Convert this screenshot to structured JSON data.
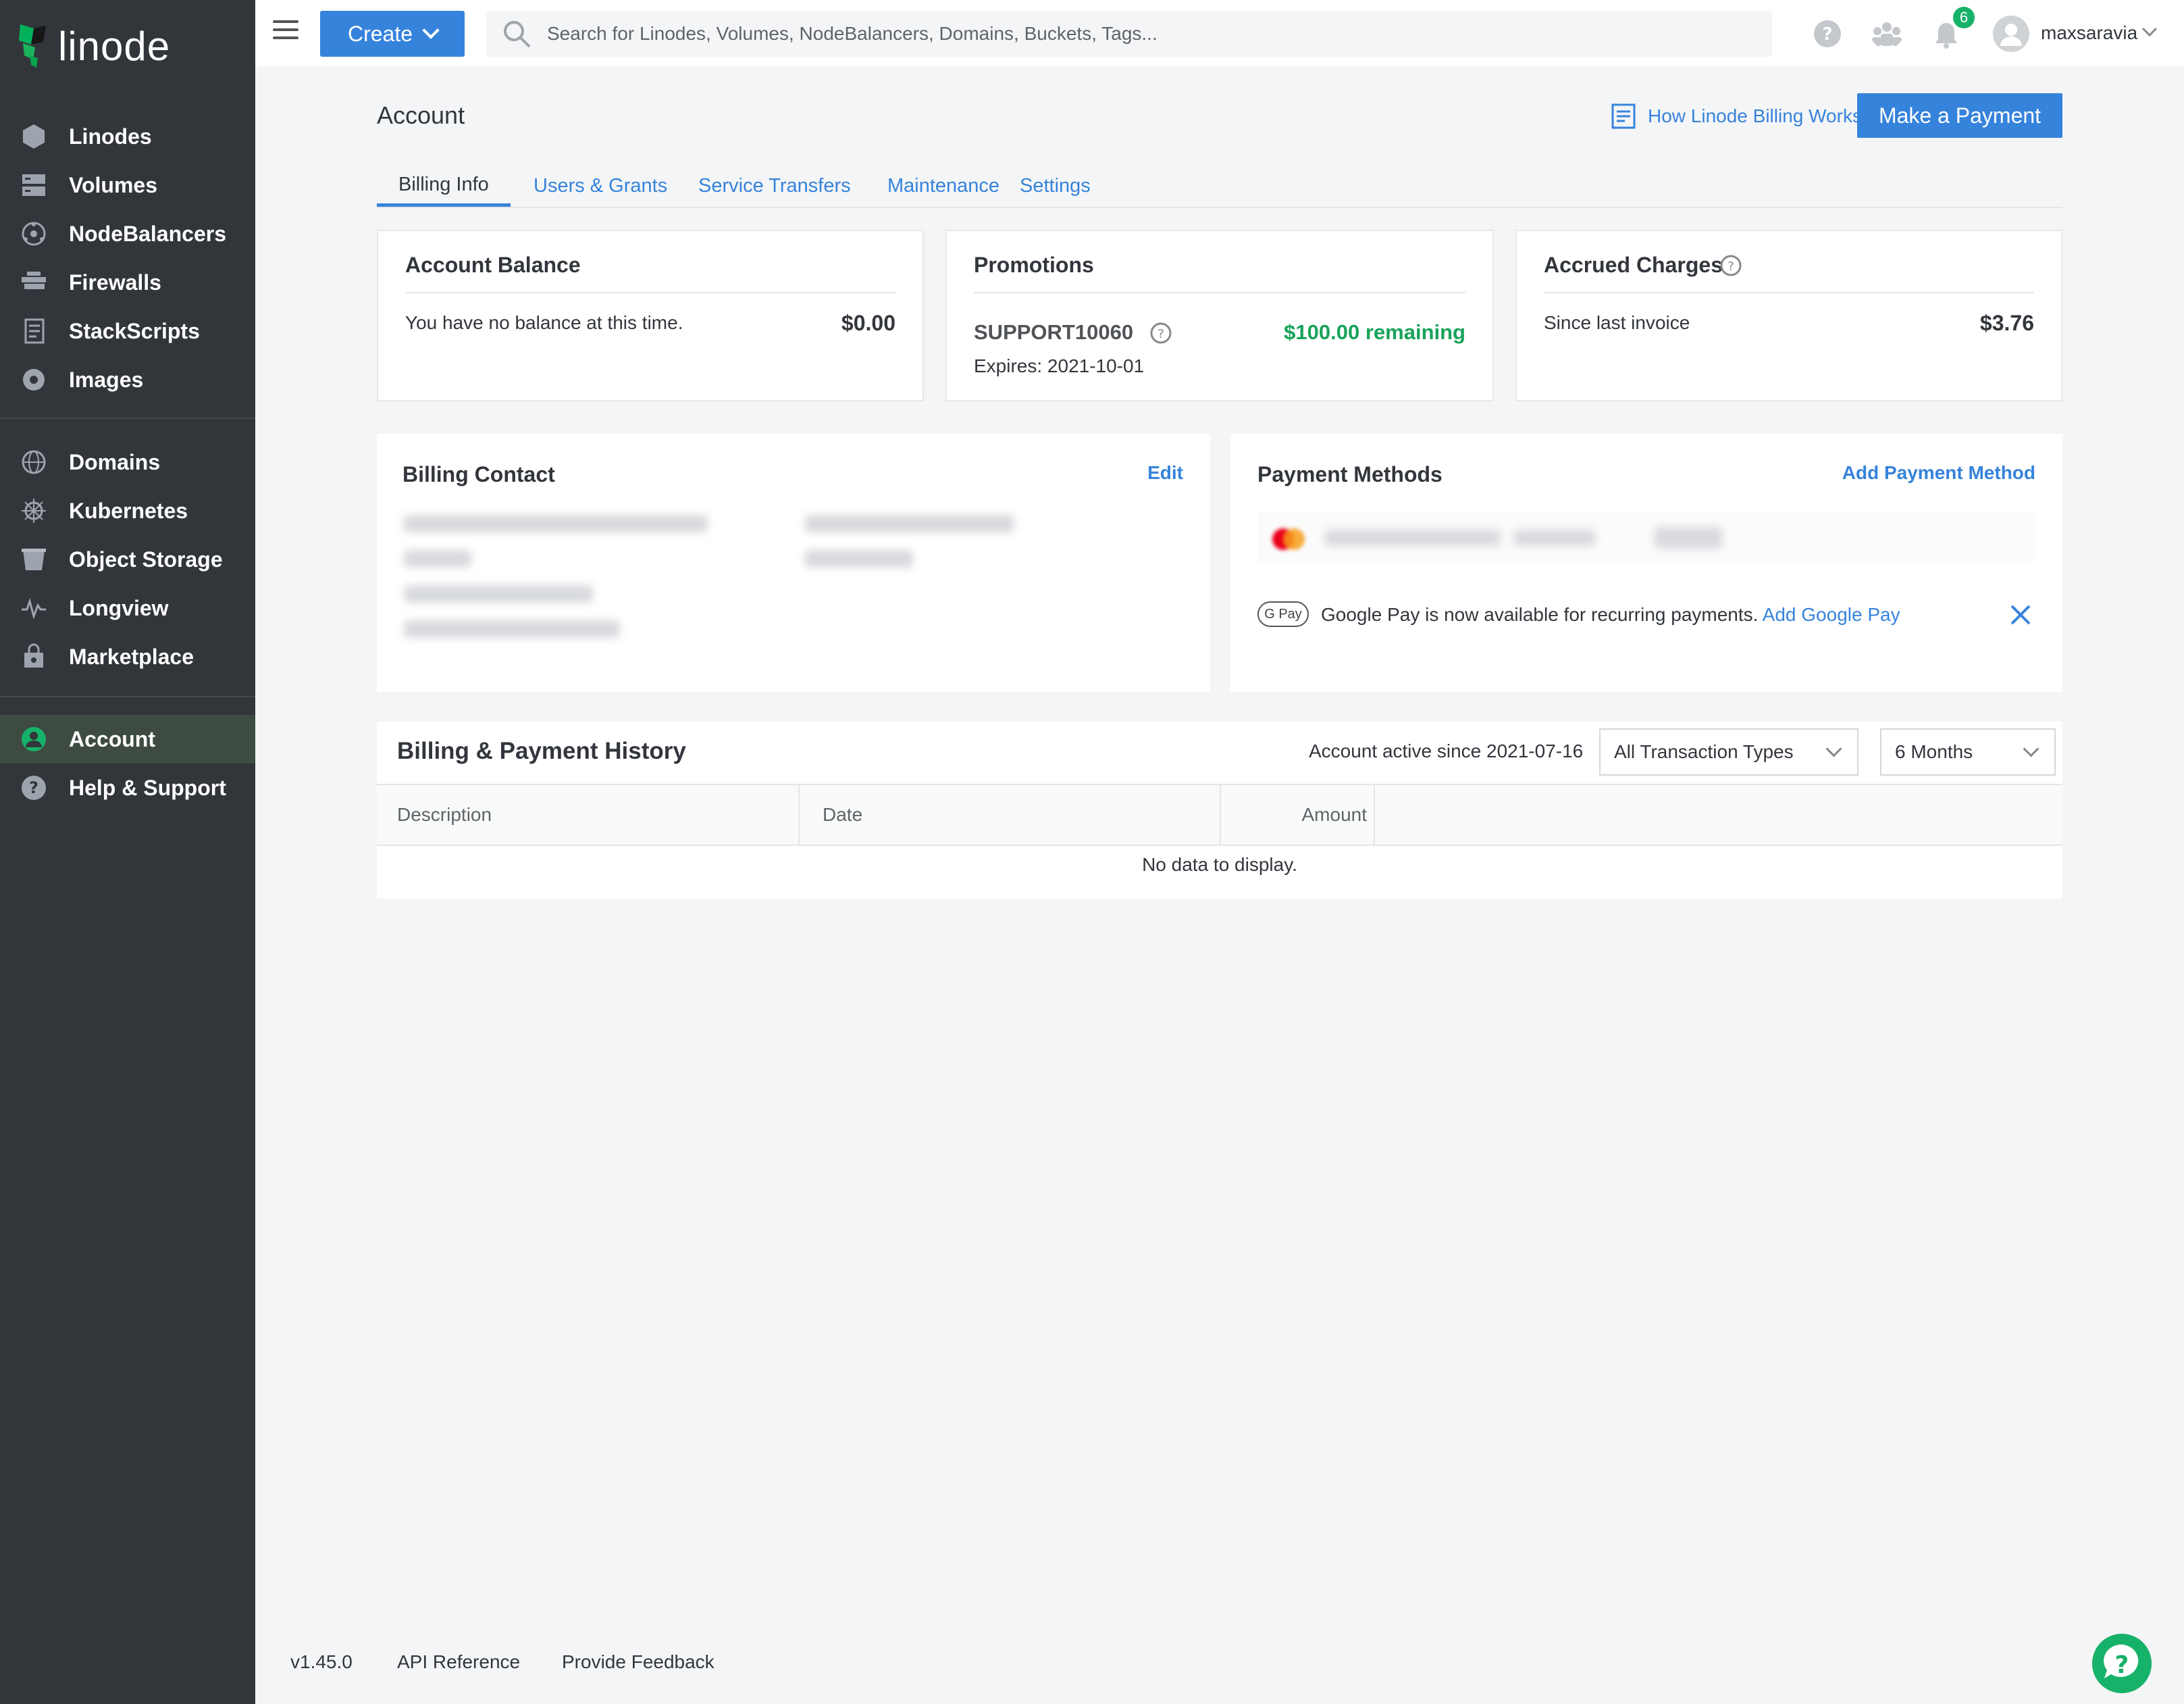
{
  "brand": {
    "name": "linode"
  },
  "sidebar": {
    "primary": [
      {
        "label": "Linodes",
        "icon": "linodes-icon"
      },
      {
        "label": "Volumes",
        "icon": "volumes-icon"
      },
      {
        "label": "NodeBalancers",
        "icon": "nodebalancers-icon"
      },
      {
        "label": "Firewalls",
        "icon": "firewalls-icon"
      },
      {
        "label": "StackScripts",
        "icon": "stackscripts-icon"
      },
      {
        "label": "Images",
        "icon": "images-icon"
      }
    ],
    "secondary": [
      {
        "label": "Domains",
        "icon": "domains-icon"
      },
      {
        "label": "Kubernetes",
        "icon": "kubernetes-icon"
      },
      {
        "label": "Object Storage",
        "icon": "object-storage-icon"
      },
      {
        "label": "Longview",
        "icon": "longview-icon"
      },
      {
        "label": "Marketplace",
        "icon": "marketplace-icon"
      }
    ],
    "tertiary": [
      {
        "label": "Account",
        "icon": "account-icon",
        "active": true
      },
      {
        "label": "Help & Support",
        "icon": "help-icon"
      }
    ]
  },
  "topbar": {
    "create_label": "Create",
    "search_placeholder": "Search for Linodes, Volumes, NodeBalancers, Domains, Buckets, Tags...",
    "notifications_count": "6",
    "username": "maxsaravia"
  },
  "page": {
    "title": "Account",
    "billing_link": "How Linode Billing Works",
    "make_payment": "Make a Payment",
    "tabs": [
      "Billing Info",
      "Users & Grants",
      "Service Transfers",
      "Maintenance",
      "Settings"
    ]
  },
  "account_balance": {
    "title": "Account Balance",
    "message": "You have no balance at this time.",
    "amount": "$0.00"
  },
  "promotions": {
    "title": "Promotions",
    "code": "SUPPORT10060",
    "remaining": "$100.00 remaining",
    "expires": "Expires: 2021-10-01"
  },
  "accrued": {
    "title": "Accrued Charges",
    "label": "Since last invoice",
    "amount": "$3.76"
  },
  "billing_contact": {
    "title": "Billing Contact",
    "edit": "Edit"
  },
  "payment_methods": {
    "title": "Payment Methods",
    "add": "Add Payment Method",
    "gpay_badge": "G Pay",
    "gpay_message": "Google Pay is now available for recurring payments.",
    "gpay_link": "Add Google Pay"
  },
  "history": {
    "title": "Billing & Payment History",
    "active_since": "Account active since 2021-07-16",
    "type_filter": "All Transaction Types",
    "period_filter": "6 Months",
    "columns": [
      "Description",
      "Date",
      "Amount"
    ],
    "empty": "No data to display."
  },
  "footer": {
    "version": "v1.45.0",
    "api": "API Reference",
    "feedback": "Provide Feedback"
  },
  "colors": {
    "accent": "#3683dc",
    "sidebar": "#32363b",
    "success": "#17b26a"
  }
}
